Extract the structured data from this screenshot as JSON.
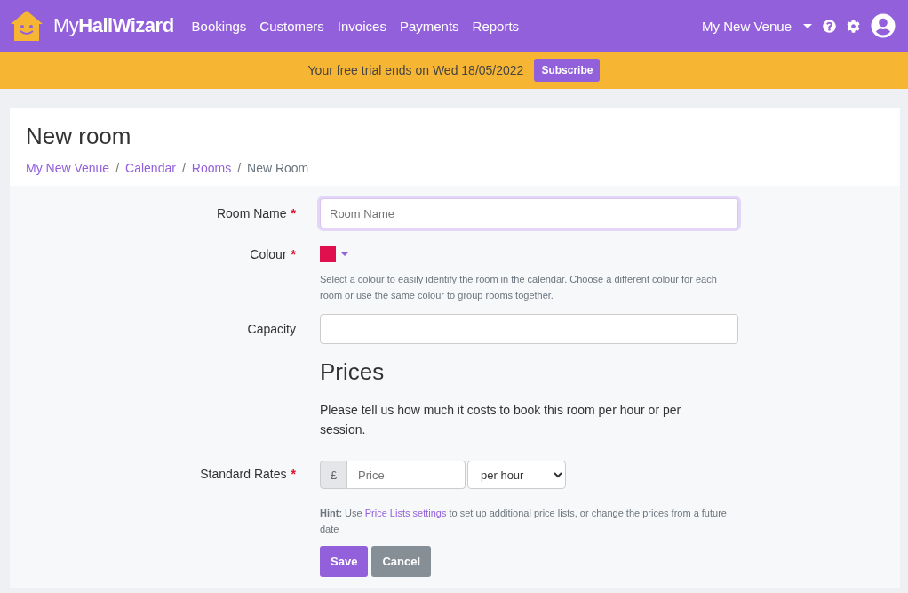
{
  "navbar": {
    "logo": "My**HallWizard**",
    "links": [
      "Bookings",
      "Customers",
      "Invoices",
      "Payments",
      "Reports"
    ],
    "venue": "My New Venue"
  },
  "trial_banner": {
    "text": "Your free trial ends on Wed 18/05/2022",
    "button": "Subscribe"
  },
  "page": {
    "title": "New room",
    "breadcrumb_separator": "/",
    "breadcrumb": [
      {
        "label": "My New Venue",
        "link": true
      },
      {
        "label": "Calendar",
        "link": true
      },
      {
        "label": "Rooms",
        "link": true
      },
      {
        "label": "New Room",
        "link": false
      }
    ]
  },
  "form": {
    "room_name": {
      "label": "Room Name",
      "mark": "*",
      "placeholder": "Room Name",
      "focused": true
    },
    "colour": {
      "label": "Colour",
      "mark": "*",
      "color": "#e0104e",
      "help": "Select a colour to easily identify the room in the calendar. Choose a different colour for each room or use the same colour to group rooms together."
    },
    "capacity": {
      "label": "Capacity"
    },
    "prices_heading": "Prices",
    "prices_intro": "Please tell us how much it costs to book this room per hour or per session.",
    "standard_rates": {
      "label": "Standard Rates",
      "mark": "*",
      "currency": "£",
      "placeholder": "Price",
      "unit": "per hour"
    },
    "hint": {
      "before": "**Hint:** Use ",
      "link": "Price Lists settings",
      "after": " to set up additional price lists, or change the prices from a future date"
    },
    "buttons": [
      {
        "label": "Save",
        "kind": "primary"
      },
      {
        "label": "Cancel",
        "kind": "secondary"
      }
    ]
  }
}
